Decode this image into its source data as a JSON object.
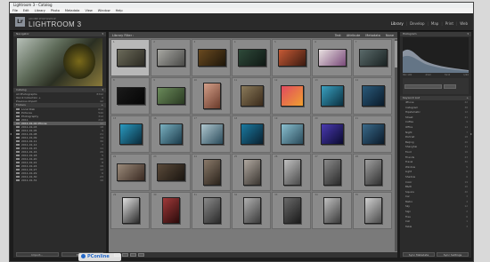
{
  "app": {
    "window_title": "Lightroom 3 - Catalog",
    "menu": [
      "File",
      "Edit",
      "Library",
      "Photo",
      "Metadata",
      "View",
      "Window",
      "Help"
    ],
    "subtitle": "ADOBE PHOTOSHOP",
    "product_name": "LIGHTROOM 3",
    "logo_text": "Lr"
  },
  "modules": [
    {
      "label": "Library",
      "active": true
    },
    {
      "label": "Develop",
      "active": false
    },
    {
      "label": "Map",
      "active": false
    },
    {
      "label": "Print",
      "active": false
    },
    {
      "label": "Web",
      "active": false
    }
  ],
  "left": {
    "navigator": "Navigator",
    "catalog": "Catalog",
    "catalog_items": [
      {
        "label": "All Photographs",
        "count": "8342"
      },
      {
        "label": "Quick Collection +",
        "count": "0"
      },
      {
        "label": "Previous Import",
        "count": "42"
      }
    ],
    "folders": "Folders",
    "folders_list": [
      {
        "label": "Local Disk",
        "count": "612",
        "selected": false
      },
      {
        "label": "Pictures",
        "count": "540",
        "selected": false
      },
      {
        "label": "Photography",
        "count": "312",
        "selected": false
      },
      {
        "label": "2011",
        "count": "210",
        "selected": false
      },
      {
        "label": "2011-01-02 iPhone",
        "count": "42",
        "selected": true
      },
      {
        "label": "2011-01-03",
        "count": "18",
        "selected": false
      },
      {
        "label": "2011-01-05",
        "count": "9",
        "selected": false
      },
      {
        "label": "2011-01-08",
        "count": "21",
        "selected": false
      },
      {
        "label": "2011-01-09",
        "count": "14",
        "selected": false
      },
      {
        "label": "2011-01-11",
        "count": "30",
        "selected": false
      },
      {
        "label": "2011-01-12",
        "count": "7",
        "selected": false
      },
      {
        "label": "2011-01-15",
        "count": "11",
        "selected": false
      },
      {
        "label": "2011-01-16",
        "count": "26",
        "selected": false
      },
      {
        "label": "2011-01-18",
        "count": "5",
        "selected": false
      },
      {
        "label": "2011-01-20",
        "count": "16",
        "selected": false
      },
      {
        "label": "2011-01-22",
        "count": "8",
        "selected": false
      },
      {
        "label": "2011-01-24",
        "count": "19",
        "selected": false
      },
      {
        "label": "2011-01-27",
        "count": "12",
        "selected": false
      },
      {
        "label": "2011-01-29",
        "count": "6",
        "selected": false
      },
      {
        "label": "2011-01-30",
        "count": "23",
        "selected": false
      },
      {
        "label": "2011-01-31",
        "count": "10",
        "selected": false
      }
    ],
    "import_label": "Import...",
    "export_label": "Export..."
  },
  "center": {
    "filter": {
      "text": "Library Filter :",
      "text2": "Text",
      "attribute": "Attribute",
      "metadata": "Metadata",
      "none": "None"
    },
    "rows": [
      [
        {
          "n": "1",
          "sel": true,
          "shape": "land",
          "c1": "#6b6a5a",
          "c2": "#2c2a22"
        },
        {
          "n": "2",
          "sel": false,
          "shape": "land",
          "c1": "#a7a7a2",
          "c2": "#4a4a48"
        },
        {
          "n": "3",
          "sel": false,
          "shape": "land",
          "c1": "#6a4a20",
          "c2": "#1e160a"
        },
        {
          "n": "4",
          "sel": false,
          "shape": "land",
          "c1": "#2f4a3a",
          "c2": "#0f1814"
        },
        {
          "n": "5",
          "sel": false,
          "shape": "land",
          "c1": "#c65a35",
          "c2": "#3a1a10"
        },
        {
          "n": "6",
          "sel": false,
          "shape": "land",
          "c1": "#e8e0e0",
          "c2": "#7a4a7a"
        },
        {
          "n": "7",
          "sel": false,
          "shape": "land",
          "c1": "#5a6a6a",
          "c2": "#1a2222"
        }
      ],
      [
        {
          "n": "8",
          "sel": false,
          "shape": "land",
          "c1": "#1a1a1a",
          "c2": "#050505"
        },
        {
          "n": "9",
          "sel": false,
          "shape": "land",
          "c1": "#6a8a5a",
          "c2": "#2a3a22"
        },
        {
          "n": "10",
          "sel": false,
          "shape": "port",
          "c1": "#d4a08a",
          "c2": "#6a3a2a"
        },
        {
          "n": "11",
          "sel": false,
          "shape": "sq",
          "c1": "#8a7a5a",
          "c2": "#3a2a1a"
        },
        {
          "n": "12",
          "sel": false,
          "shape": "sq",
          "c1": "#e04a60",
          "c2": "#f0a030"
        },
        {
          "n": "13",
          "sel": false,
          "shape": "sq",
          "c1": "#3aa0c0",
          "c2": "#0a3040"
        },
        {
          "n": "14",
          "sel": false,
          "shape": "sq",
          "c1": "#2a5a7a",
          "c2": "#0a1a2a"
        }
      ],
      [
        {
          "n": "15",
          "sel": false,
          "shape": "sq",
          "c1": "#2a9ac0",
          "c2": "#0a2a3a"
        },
        {
          "n": "16",
          "sel": false,
          "shape": "sq",
          "c1": "#7ab0c0",
          "c2": "#1a3a4a"
        },
        {
          "n": "17",
          "sel": false,
          "shape": "sq",
          "c1": "#b0c8d0",
          "c2": "#2a4a5a"
        },
        {
          "n": "18",
          "sel": false,
          "shape": "sq",
          "c1": "#1a7aa0",
          "c2": "#0a2030"
        },
        {
          "n": "19",
          "sel": false,
          "shape": "sq",
          "c1": "#8ac0d0",
          "c2": "#2a4a5a"
        },
        {
          "n": "20",
          "sel": false,
          "shape": "sq",
          "c1": "#4a3ab0",
          "c2": "#0a0a30"
        },
        {
          "n": "21",
          "sel": false,
          "shape": "sq",
          "c1": "#3a6a8a",
          "c2": "#0a1a2a"
        }
      ],
      [
        {
          "n": "22",
          "sel": false,
          "shape": "land",
          "c1": "#9a8a7a",
          "c2": "#3a2a22"
        },
        {
          "n": "23",
          "sel": false,
          "shape": "land",
          "c1": "#5a4a3a",
          "c2": "#1a1510"
        },
        {
          "n": "24",
          "sel": false,
          "shape": "port",
          "c1": "#8a7a6a",
          "c2": "#2a221a"
        },
        {
          "n": "25",
          "sel": false,
          "shape": "port",
          "c1": "#b0a8a0",
          "c2": "#3a3530"
        },
        {
          "n": "26",
          "sel": false,
          "shape": "port",
          "c1": "#c0c0c0",
          "c2": "#4a4a4a"
        },
        {
          "n": "27",
          "sel": false,
          "shape": "port",
          "c1": "#8a8a8a",
          "c2": "#2a2a2a"
        },
        {
          "n": "28",
          "sel": false,
          "shape": "port",
          "c1": "#a0a0a0",
          "c2": "#303030"
        }
      ],
      [
        {
          "n": "29",
          "sel": false,
          "shape": "port",
          "c1": "#e0e0e0",
          "c2": "#2a2a2a"
        },
        {
          "n": "30",
          "sel": false,
          "shape": "port",
          "c1": "#a03a3a",
          "c2": "#2a0a0a"
        },
        {
          "n": "31",
          "sel": false,
          "shape": "port",
          "c1": "#8a8a8a",
          "c2": "#2a2a2a"
        },
        {
          "n": "32",
          "sel": false,
          "shape": "port",
          "c1": "#b0b0b0",
          "c2": "#3a3a3a"
        },
        {
          "n": "33",
          "sel": false,
          "shape": "port",
          "c1": "#6a6a6a",
          "c2": "#1a1a1a"
        },
        {
          "n": "34",
          "sel": false,
          "shape": "port",
          "c1": "#c0c0c0",
          "c2": "#3a3a3a"
        },
        {
          "n": "35",
          "sel": false,
          "shape": "port",
          "c1": "#d0d0d0",
          "c2": "#4a4a4a"
        }
      ]
    ]
  },
  "right": {
    "histogram": "Histogram",
    "exif": [
      "ISO 100",
      "4mm",
      "f/2.8",
      "1/20"
    ],
    "keyword_header": "Keyword List",
    "keywords": [
      {
        "label": "iPhone",
        "count": "42"
      },
      {
        "label": "Instagram",
        "count": "38"
      },
      {
        "label": "Hipstamatic",
        "count": "12"
      },
      {
        "label": "Street",
        "count": "21"
      },
      {
        "label": "Coffee",
        "count": "9"
      },
      {
        "label": "Office",
        "count": "14"
      },
      {
        "label": "Night",
        "count": "7"
      },
      {
        "label": "Portrait",
        "count": "18"
      },
      {
        "label": "Beijing",
        "count": "26"
      },
      {
        "label": "Shanghai",
        "count": "11"
      },
      {
        "label": "Food",
        "count": "16"
      },
      {
        "label": "Friends",
        "count": "23"
      },
      {
        "label": "Travel",
        "count": "30"
      },
      {
        "label": "Window",
        "count": "5"
      },
      {
        "label": "Light",
        "count": "8"
      },
      {
        "label": "Shadow",
        "count": "6"
      },
      {
        "label": "Color",
        "count": "19"
      },
      {
        "label": "B&W",
        "count": "10"
      },
      {
        "label": "Square",
        "count": "40"
      },
      {
        "label": "Car",
        "count": "3"
      },
      {
        "label": "Metro",
        "count": "4"
      },
      {
        "label": "Sky",
        "count": "12"
      },
      {
        "label": "Sign",
        "count": "2"
      },
      {
        "label": "Tree",
        "count": "6"
      },
      {
        "label": "Cat",
        "count": "1"
      },
      {
        "label": "Table",
        "count": "3"
      }
    ],
    "sync_label": "Sync Metadata",
    "sync2_label": "Sync Settings"
  },
  "watermark": "PConline"
}
